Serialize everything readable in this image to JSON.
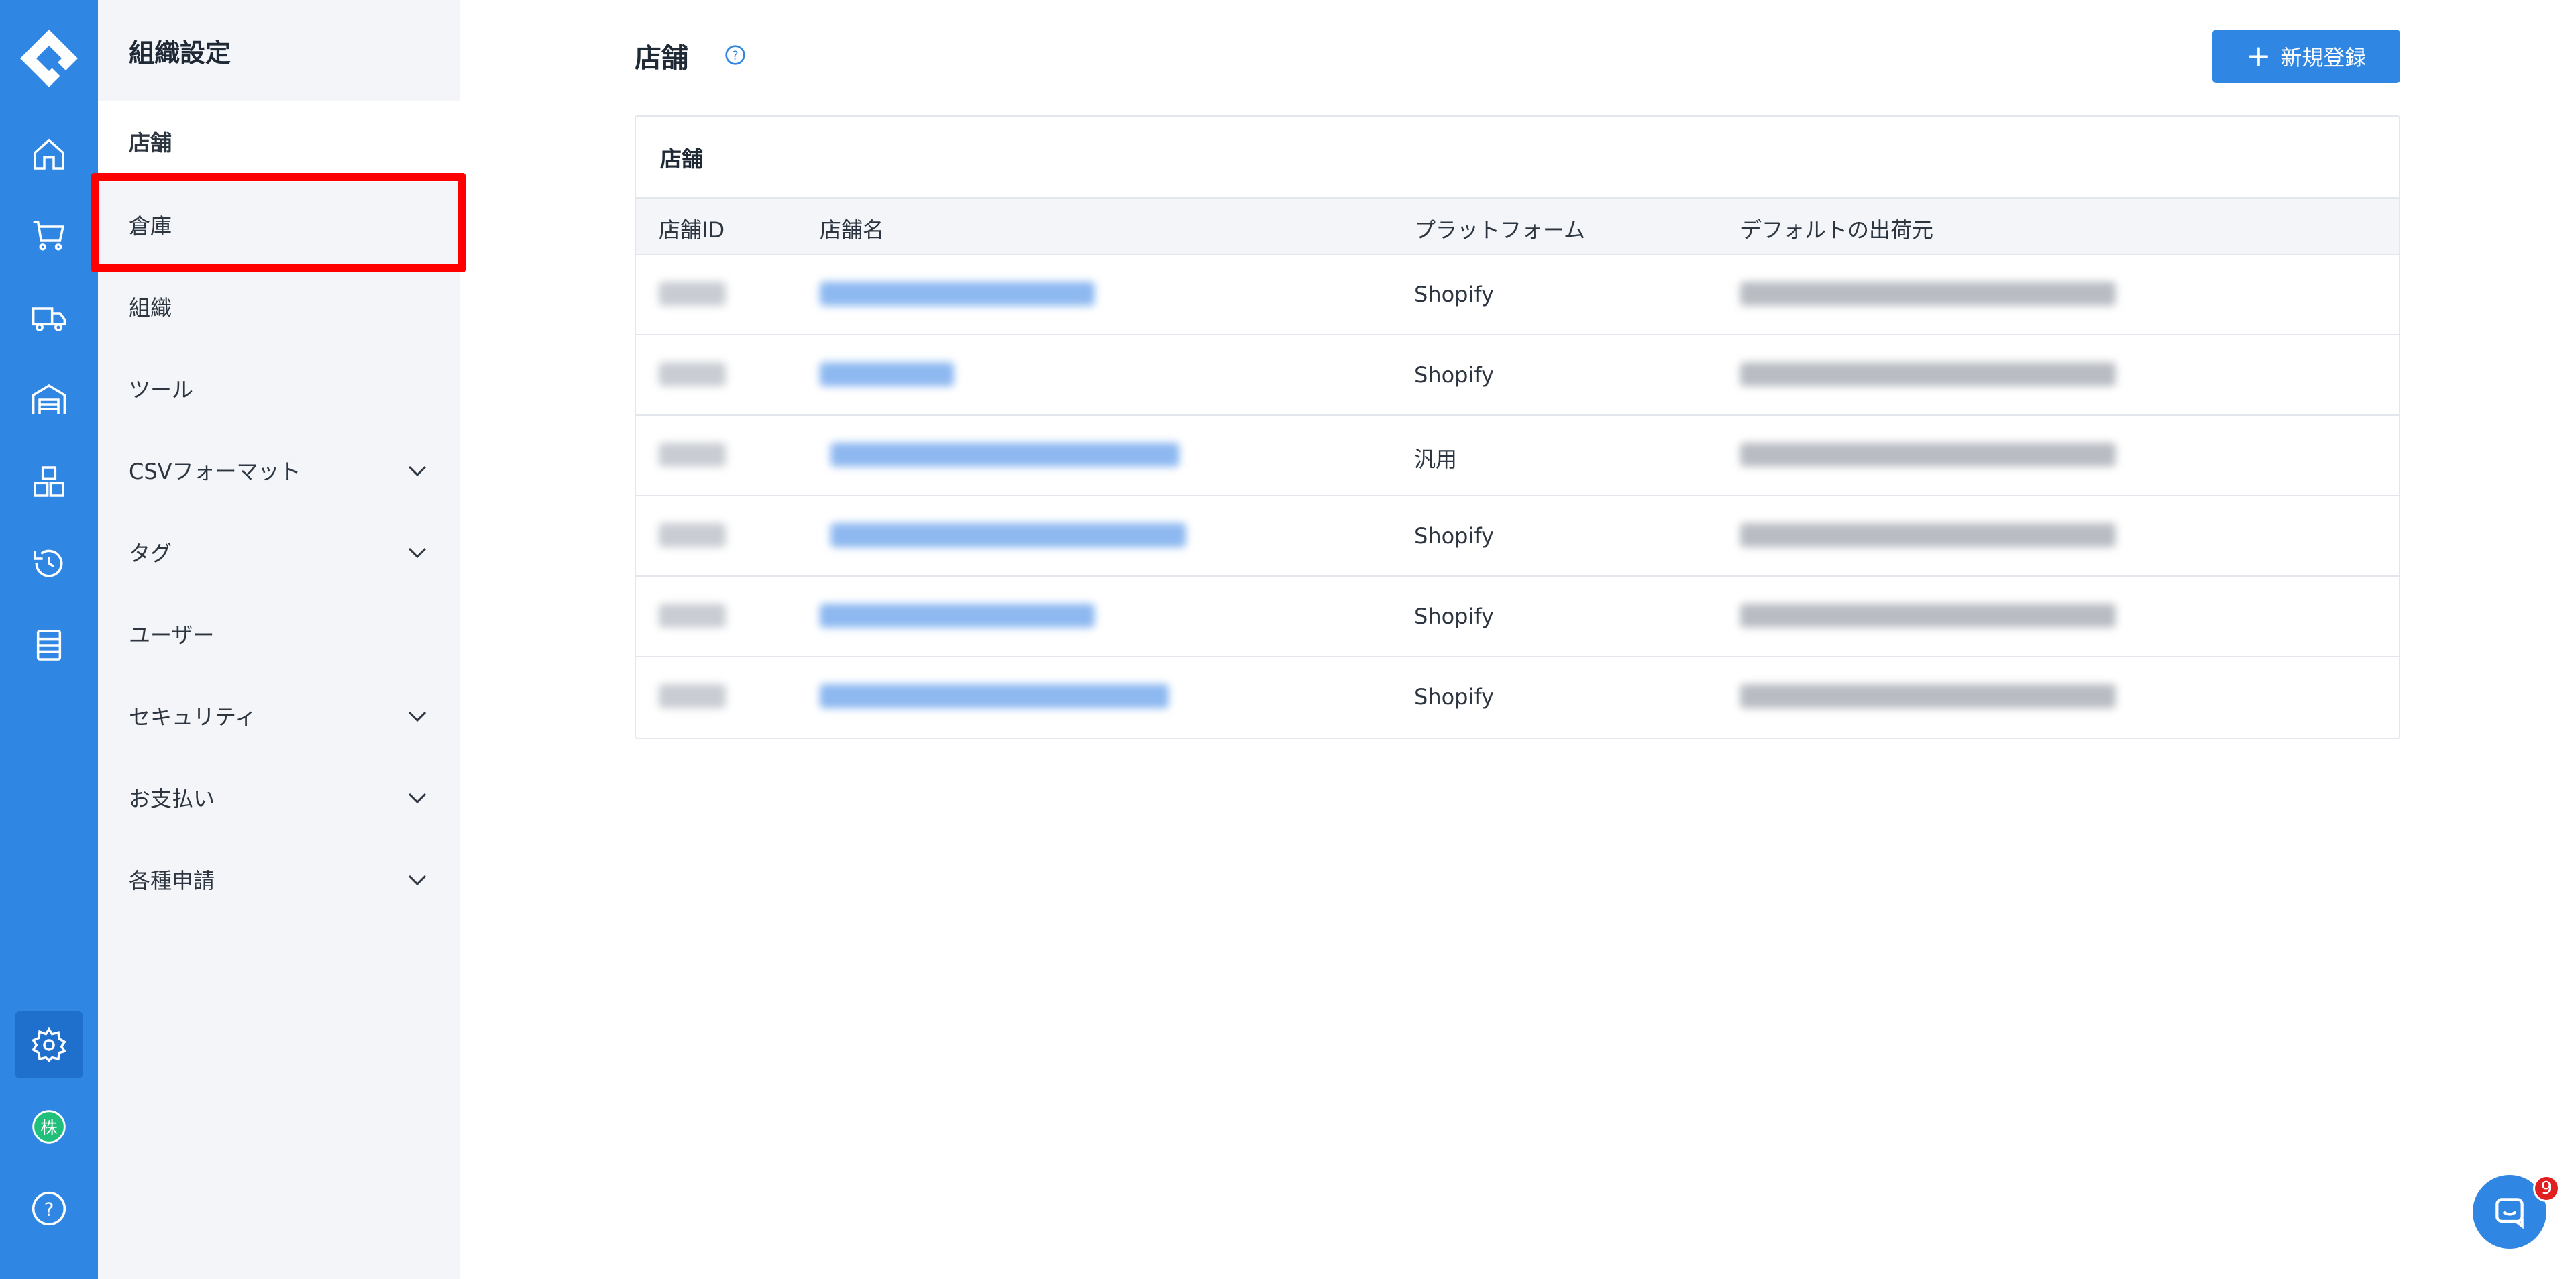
{
  "rail": {
    "items": [
      "home-icon",
      "cart-icon",
      "truck-icon",
      "warehouse-icon",
      "boxes-icon",
      "history-icon",
      "list-icon"
    ],
    "bottom": [
      "settings-icon",
      "company-icon",
      "help-icon"
    ],
    "company_glyph": "株",
    "help_glyph": "?"
  },
  "sidebar": {
    "title": "組織設定",
    "items": [
      {
        "label": "店舗",
        "expandable": false
      },
      {
        "label": "倉庫",
        "expandable": false
      },
      {
        "label": "組織",
        "expandable": false
      },
      {
        "label": "ツール",
        "expandable": false
      },
      {
        "label": "CSVフォーマット",
        "expandable": true
      },
      {
        "label": "タグ",
        "expandable": true
      },
      {
        "label": "ユーザー",
        "expandable": false
      },
      {
        "label": "セキュリティ",
        "expandable": true
      },
      {
        "label": "お支払い",
        "expandable": true
      },
      {
        "label": "各種申請",
        "expandable": true
      }
    ]
  },
  "main": {
    "title": "店舗",
    "help_glyph": "?",
    "new_button": {
      "plus": "+",
      "label": "新規登録"
    },
    "card_title": "店舗",
    "columns": [
      "店舗ID",
      "店舗名",
      "プラットフォーム",
      "デフォルトの出荷元"
    ],
    "rows": [
      {
        "platform": "Shopify"
      },
      {
        "platform": "Shopify"
      },
      {
        "platform": "汎用"
      },
      {
        "platform": "Shopify"
      },
      {
        "platform": "Shopify"
      },
      {
        "platform": "Shopify"
      }
    ]
  },
  "chat": {
    "badge_count": "9"
  },
  "colors": {
    "brand": "#2f86e3",
    "highlight": "#ff0000",
    "badge": "#e02020"
  }
}
